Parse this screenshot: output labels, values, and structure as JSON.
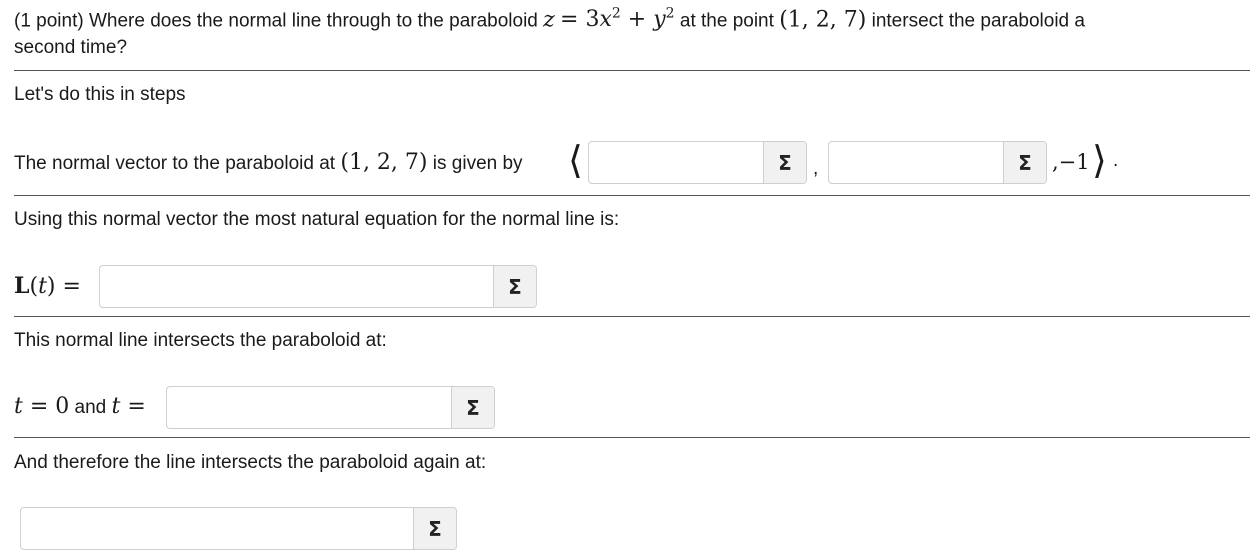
{
  "question": {
    "prefix": "(1 point) Where does the normal line through to the paraboloid",
    "eq_lhs": "z",
    "eq_rhs": "= 3x",
    "middle": "at the point",
    "point": "(1, 2, 7)",
    "suffix": "intersect the paraboloid a",
    "line2": "second time?"
  },
  "steps_intro": "Let's do this in steps",
  "step1": {
    "text": "The normal vector to the paraboloid at",
    "point": "(1, 2, 7)",
    "text2": "is given by",
    "input1_value": "",
    "input2_value": "",
    "separator": ",",
    "tail": ",−1",
    "period": "."
  },
  "step2": {
    "text": "Using this normal vector the most natural equation for the normal line is:",
    "lhs": "L(t) =",
    "input_value": ""
  },
  "step3": {
    "text": "This normal line intersects the paraboloid at:",
    "t0": "t = 0",
    "and": "and",
    "t_eq": "t =",
    "input_value": ""
  },
  "step4": {
    "text": "And therefore the line intersects the paraboloid again at:",
    "input_value": ""
  },
  "equation_editor_symbol": "Σ"
}
